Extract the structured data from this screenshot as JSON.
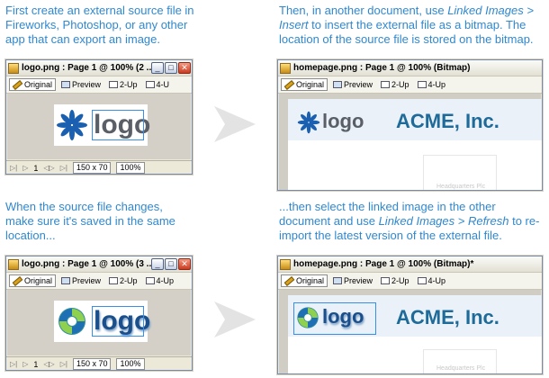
{
  "captions": {
    "top_left": "First create an external source file in Fireworks, Photoshop, or any other app that can export an image.",
    "top_right_1": "Then, in another document, use ",
    "top_right_link": "Linked Images > Insert",
    "top_right_2": " to insert the external file as a bitmap.  The location of the source file is stored on the bitmap.",
    "bottom_left": "When the source file changes, make sure it's saved in the same location...",
    "bottom_right_1": "...then select the linked image in the other document and use ",
    "bottom_right_link": "Linked Images > Refresh",
    "bottom_right_2": " to re-import the latest version of the external file."
  },
  "windows": {
    "w1": {
      "title": "logo.png : Page 1 @ 100% (2 ...",
      "zoom": "100%",
      "size": "150 x 70",
      "page": "1"
    },
    "w2": {
      "title": "homepage.png : Page 1 @ 100% (Bitmap)"
    },
    "w3": {
      "title": "logo.png : Page 1 @ 100% (3 ...",
      "zoom": "100%",
      "size": "150 x 70",
      "page": "1"
    },
    "w4": {
      "title": "homepage.png : Page 1 @ 100% (Bitmap)*"
    }
  },
  "tabs": {
    "original": "Original",
    "preview": "Preview",
    "two_up": "2-Up",
    "four_up": "4-Up",
    "four_up_short": "4-U"
  },
  "logo_text": "logo",
  "acme": "ACME, Inc.",
  "hq": "Headquarters Plc",
  "colors": {
    "caption": "#2f88d0",
    "acme": "#1e6b9a",
    "arrow": "#e3e3e3"
  },
  "icons": [
    "arrow-right-icon",
    "fireworks-icon",
    "pencil-icon",
    "preview-icon",
    "minimize-icon",
    "maximize-icon",
    "close-icon"
  ]
}
